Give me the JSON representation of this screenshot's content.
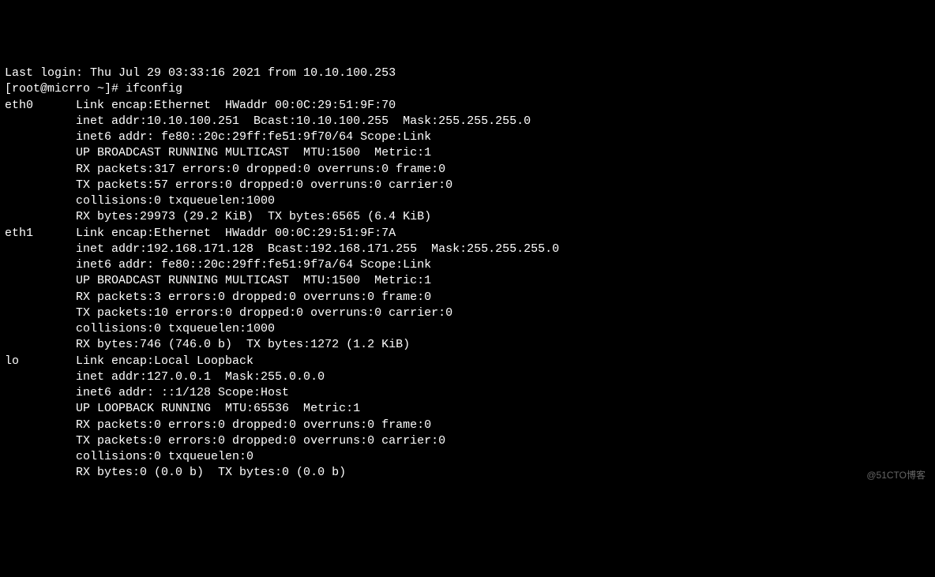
{
  "header": {
    "last_login": "Last login: Thu Jul 29 03:33:16 2021 from 10.10.100.253",
    "prompt": "[root@micrro ~]# ifconfig"
  },
  "interfaces": [
    {
      "name": "eth0",
      "lines": [
        "Link encap:Ethernet  HWaddr 00:0C:29:51:9F:70",
        "inet addr:10.10.100.251  Bcast:10.10.100.255  Mask:255.255.255.0",
        "inet6 addr: fe80::20c:29ff:fe51:9f70/64 Scope:Link",
        "UP BROADCAST RUNNING MULTICAST  MTU:1500  Metric:1",
        "RX packets:317 errors:0 dropped:0 overruns:0 frame:0",
        "TX packets:57 errors:0 dropped:0 overruns:0 carrier:0",
        "collisions:0 txqueuelen:1000",
        "RX bytes:29973 (29.2 KiB)  TX bytes:6565 (6.4 KiB)"
      ]
    },
    {
      "name": "eth1",
      "lines": [
        "Link encap:Ethernet  HWaddr 00:0C:29:51:9F:7A",
        "inet addr:192.168.171.128  Bcast:192.168.171.255  Mask:255.255.255.0",
        "inet6 addr: fe80::20c:29ff:fe51:9f7a/64 Scope:Link",
        "UP BROADCAST RUNNING MULTICAST  MTU:1500  Metric:1",
        "RX packets:3 errors:0 dropped:0 overruns:0 frame:0",
        "TX packets:10 errors:0 dropped:0 overruns:0 carrier:0",
        "collisions:0 txqueuelen:1000",
        "RX bytes:746 (746.0 b)  TX bytes:1272 (1.2 KiB)"
      ]
    },
    {
      "name": "lo",
      "lines": [
        "Link encap:Local Loopback",
        "inet addr:127.0.0.1  Mask:255.0.0.0",
        "inet6 addr: ::1/128 Scope:Host",
        "UP LOOPBACK RUNNING  MTU:65536  Metric:1",
        "RX packets:0 errors:0 dropped:0 overruns:0 frame:0",
        "TX packets:0 errors:0 dropped:0 overruns:0 carrier:0",
        "collisions:0 txqueuelen:0",
        "RX bytes:0 (0.0 b)  TX bytes:0 (0.0 b)"
      ]
    }
  ],
  "watermark": "@51CTO博客"
}
